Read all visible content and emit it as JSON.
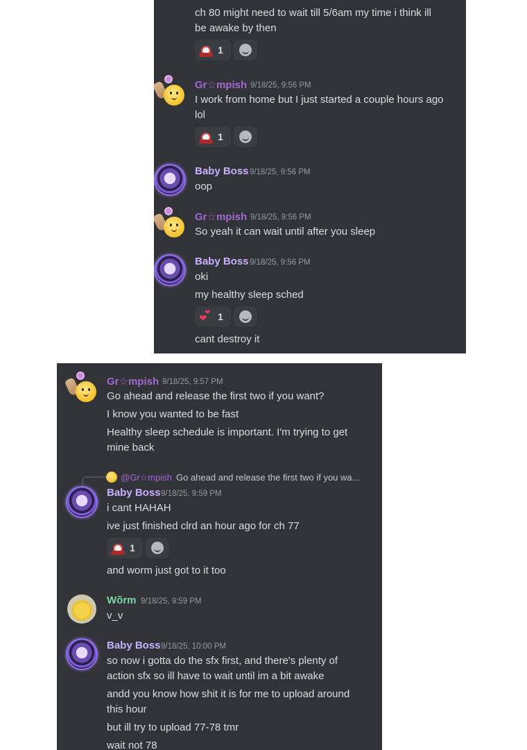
{
  "top": {
    "partial_line": "ch 80 might need to wait till 5/6am my time i think ill",
    "partial_line2": "be awake by then",
    "r0": {
      "emoji": "alarm-clock",
      "count": "1"
    },
    "m1": {
      "author": "Gr☆mpish",
      "time": "9/18/25, 9:56 PM",
      "l1": "I work from home but I just started a couple hours ago",
      "l2": "lol",
      "react": {
        "emoji": "alarm-clock",
        "count": "1"
      }
    },
    "m2": {
      "author": "Baby Boss",
      "time": "9/18/25, 9:56 PM",
      "l1": "oop"
    },
    "m3": {
      "author": "Gr☆mpish",
      "time": "9/18/25, 9:56 PM",
      "l1": "So yeah it can wait until after you sleep"
    },
    "m4": {
      "author": "Baby Boss",
      "time": "9/18/25, 9:56 PM",
      "l1": "oki",
      "l2": "my healthy sleep sched",
      "react": {
        "emoji": "hearts",
        "count": "1"
      },
      "l3": "cant destroy it"
    }
  },
  "bottom": {
    "m1": {
      "author": "Gr☆mpish",
      "time": "9/18/25, 9:57 PM",
      "l1": "Go ahead and release the first two if you want?",
      "l2": "I know you wanted to be fast",
      "l3": "Healthy sleep schedule is important. I'm trying to get",
      "l4": "mine back"
    },
    "reply": {
      "mention": "@Gr☆mpish",
      "text": "Go ahead and release the first two if you wa..."
    },
    "m2": {
      "author": "Baby Boss",
      "time": "9/18/25, 9:59 PM",
      "l1": "i cant HAHAH",
      "l2": "ive just finished clrd an hour ago for ch 77",
      "react": {
        "emoji": "alarm-clock",
        "count": "1"
      },
      "l3": "and worm just got to it too"
    },
    "m3": {
      "author": "Wõrm",
      "time": "9/18/25, 9:59 PM",
      "l1": "v_v"
    },
    "m4": {
      "author": "Baby Boss",
      "time": "9/18/25, 10:00 PM",
      "l1": "so now i gotta do the sfx first, and there's plenty of",
      "l2": "action sfx so ill have to wait until im a bit awake",
      "l3": "andd you know how shit it is for me to upload around",
      "l4": "this hour",
      "l5": "but ill try to upload 77-78 tmr",
      "l6": "wait not 78"
    }
  }
}
